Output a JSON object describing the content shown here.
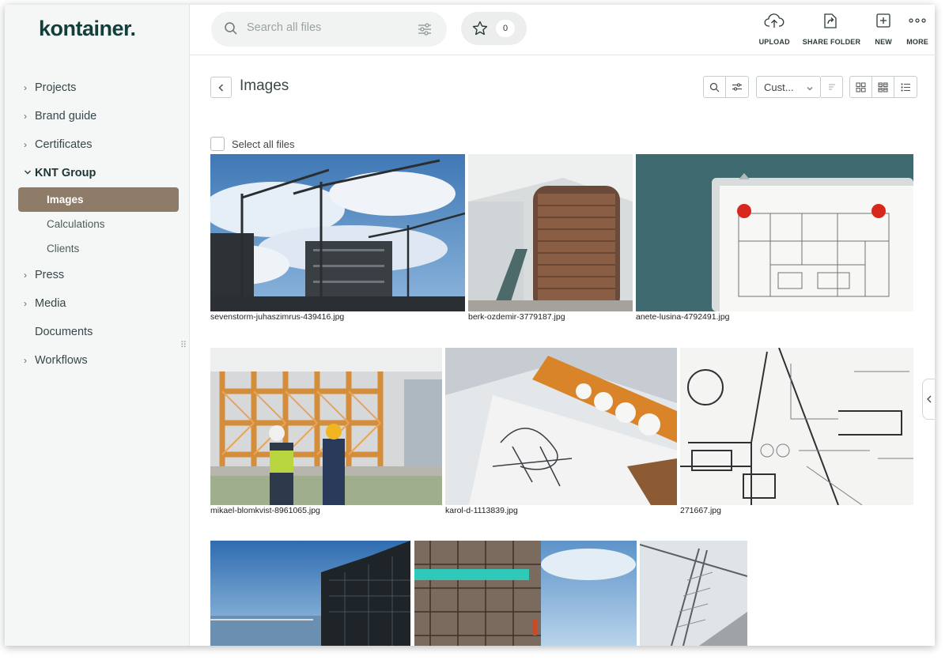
{
  "app": {
    "logo": "kontainer."
  },
  "search": {
    "placeholder": "Search all files"
  },
  "favorites": {
    "count": "0"
  },
  "actions": [
    {
      "label": "UPLOAD",
      "icon": "cloud-upload-icon"
    },
    {
      "label": "SHARE FOLDER",
      "icon": "share-folder-icon"
    },
    {
      "label": "NEW",
      "icon": "new-file-icon"
    },
    {
      "label": "MORE",
      "icon": "more-dots-icon"
    }
  ],
  "sidebar": {
    "items": [
      {
        "label": "Projects"
      },
      {
        "label": "Brand guide"
      },
      {
        "label": "Certificates"
      },
      {
        "label": "KNT Group"
      },
      {
        "label": "Press"
      },
      {
        "label": "Media"
      },
      {
        "label": "Documents"
      },
      {
        "label": "Workflows"
      }
    ],
    "sub_items": [
      {
        "label": "Images"
      },
      {
        "label": "Calculations"
      },
      {
        "label": "Clients"
      }
    ]
  },
  "main": {
    "title": "Images",
    "sort_label": "Cust...",
    "select_all_label": "Select all files"
  },
  "files": [
    {
      "name": "sevenstorm-juhaszimrus-439416.jpg"
    },
    {
      "name": "berk-ozdemir-3779187.jpg"
    },
    {
      "name": "anete-lusina-4792491.jpg"
    },
    {
      "name": "mikael-blomkvist-8961065.jpg"
    },
    {
      "name": "karol-d-1113839.jpg"
    },
    {
      "name": "271667.jpg"
    },
    {
      "name": ""
    },
    {
      "name": ""
    },
    {
      "name": ""
    }
  ],
  "colors": {
    "brand": "#123f3c",
    "active_nav": "#8f7c68",
    "sidebar_bg": "#f5f7f6"
  }
}
